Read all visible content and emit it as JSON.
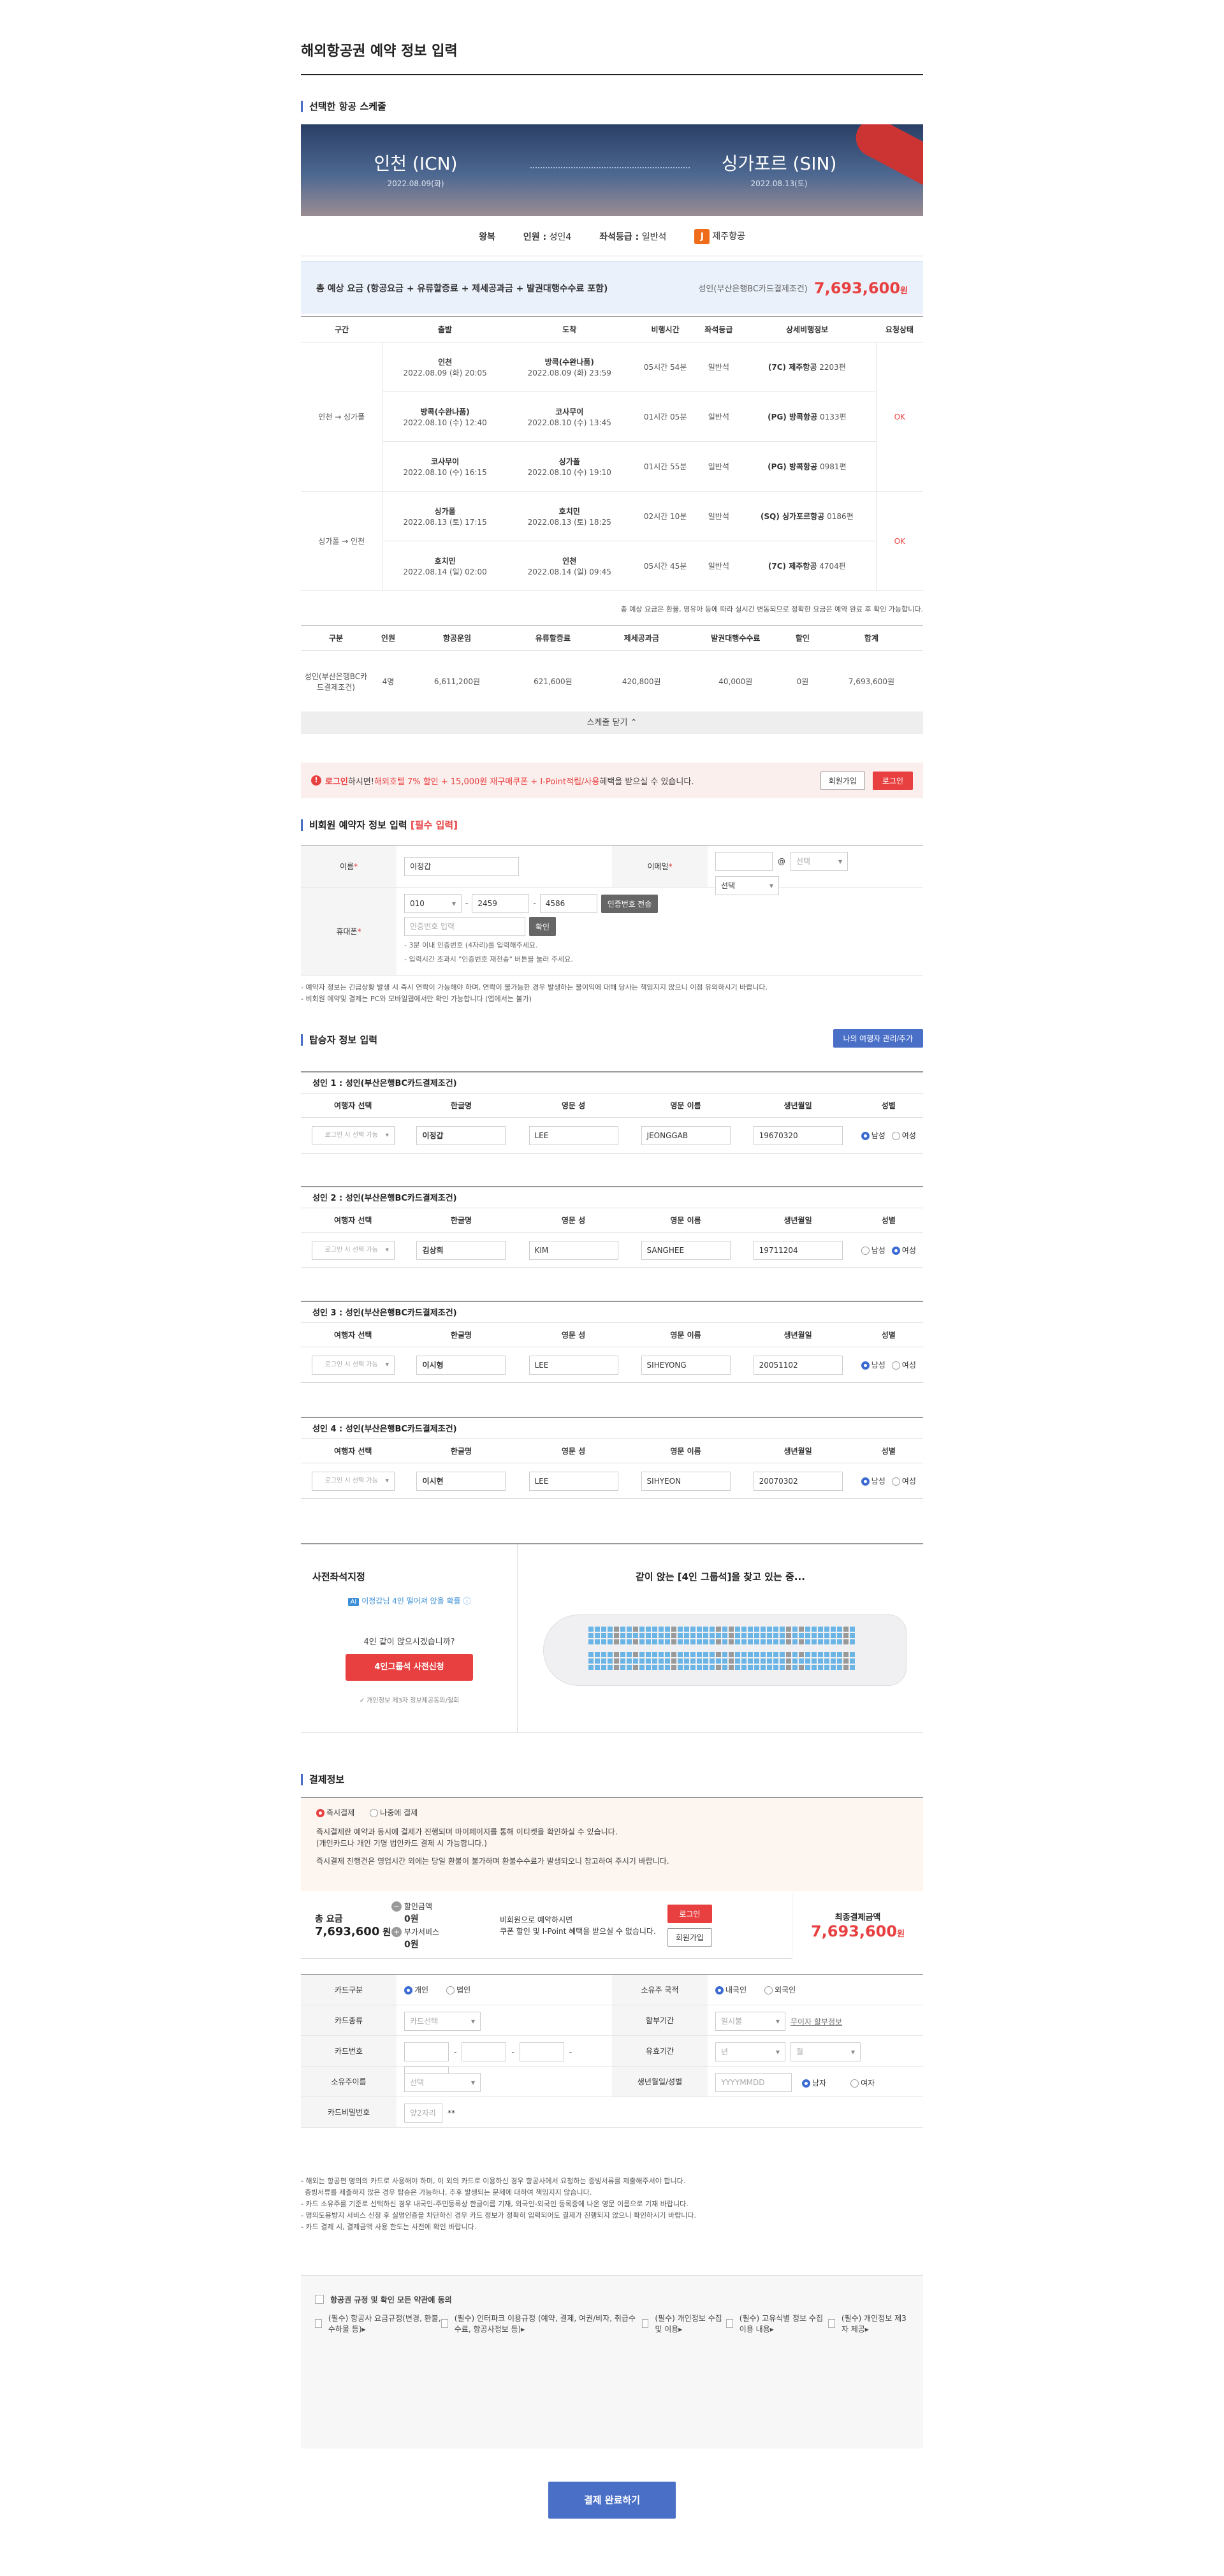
{
  "page_title": "해외항공권 예약 정보 입력",
  "schedule": {
    "section_title": "선택한 항공 스케줄",
    "from_city": "인천 (ICN)",
    "from_date": "2022.08.09(화)",
    "to_city": "싱가포르 (SIN)",
    "to_date": "2022.08.13(토)",
    "trip_type": "왕복",
    "pax_label": "인원 :",
    "pax_value": "성인4",
    "class_label": "좌석등급 :",
    "class_value": "일반석",
    "airline": "제주항공",
    "airline_icon": "J",
    "fare_label": "총 예상 요금 (항공요금 + 유류할증료 + 제세공과금 + 발권대행수수료 포함)",
    "fare_sub": "성인(부산은행BC카드결제조건)",
    "fare_amount": "7,693,600",
    "fare_unit": "원",
    "headers": [
      "구간",
      "출발",
      "도착",
      "비행시간",
      "좌석등급",
      "상세비행정보",
      "요청상태"
    ],
    "segments": [
      {
        "route": "인천 → 싱가폴",
        "status": "OK",
        "rows": [
          {
            "dep": "인천",
            "dep_time": "2022.08.09 (화) 20:05",
            "arr": "방콕(수완나품)",
            "arr_time": "2022.08.09 (화) 23:59",
            "dur": "05시간 54분",
            "cls": "일반석",
            "code": "(7C) 제주항공",
            "flight": "2203편"
          },
          {
            "dep": "방콕(수완나품)",
            "dep_time": "2022.08.10 (수) 12:40",
            "arr": "코사무이",
            "arr_time": "2022.08.10 (수) 13:45",
            "dur": "01시간 05분",
            "cls": "일반석",
            "code": "(PG) 방콕항공",
            "flight": "0133편"
          },
          {
            "dep": "코사무이",
            "dep_time": "2022.08.10 (수) 16:15",
            "arr": "싱가폴",
            "arr_time": "2022.08.10 (수) 19:10",
            "dur": "01시간 55분",
            "cls": "일반석",
            "code": "(PG) 방콕항공",
            "flight": "0981편"
          }
        ]
      },
      {
        "route": "싱가폴 → 인천",
        "status": "OK",
        "rows": [
          {
            "dep": "싱가폴",
            "dep_time": "2022.08.13 (토) 17:15",
            "arr": "호치민",
            "arr_time": "2022.08.13 (토) 18:25",
            "dur": "02시간 10분",
            "cls": "일반석",
            "code": "(SQ) 싱가포르항공",
            "flight": "0186편"
          },
          {
            "dep": "호치민",
            "dep_time": "2022.08.14 (일) 02:00",
            "arr": "인천",
            "arr_time": "2022.08.14 (일) 09:45",
            "dur": "05시간 45분",
            "cls": "일반석",
            "code": "(7C) 제주항공",
            "flight": "4704편"
          }
        ]
      }
    ],
    "note": "총 예상 요금은 환율, 영유아 등에 따라 실시간 변동되므로 정확한 요금은 예약 완료 후 확인 가능합니다.",
    "price_headers": [
      "구분",
      "인원",
      "항공운임",
      "유류할증료",
      "제세공과금",
      "발권대행수수료",
      "할인",
      "합계"
    ],
    "price_row": [
      "성인(부산은행BC카드결제조건)",
      "4명",
      "6,611,200원",
      "621,600원",
      "420,800원",
      "40,000원",
      "0원",
      "7,693,600원"
    ],
    "fold": "스케줄 닫기 ⌃"
  },
  "promo": {
    "login": "로그인",
    "text1": "하시면! ",
    "hl": "해외호텔 7% 할인 + 15,000원 재구매쿠폰 + I-Point적립/사용",
    "text2": " 혜택을 받으실 수 있습니다.",
    "join": "회원가입",
    "login_btn": "로그인"
  },
  "booker": {
    "title": "비회원 예약자 정보 입력",
    "req": "[필수 입력]",
    "name_label": "이름",
    "name": "이정갑",
    "email_label": "이메일",
    "email_sel": "선택",
    "email_sel2": "선택",
    "phone_label": "휴대폰",
    "p1": "010",
    "p2": "2459",
    "p3": "4586",
    "send": "인증번호 전송",
    "code_ph": "인증번호 입력",
    "confirm": "확인",
    "hint1": "- 3분 이내 인증번호 (4자리)를 입력해주세요.",
    "hint2": "- 입력시간 초과시 \"인증번호 재전송\" 버튼을 눌러 주세요.",
    "note1": "- 예약자 정보는 긴급상황 발생 시 즉시 연락이 가능해야 하며, 연락이 불가능한 경우 발생하는 불이익에 대해 당사는 책임지지 않으니 이점 유의하시기 바랍니다.",
    "note2": "- 비회원 예약및 결제는 PC와 모바일웹에서만 확인 가능합니다 (앱에서는 불가)"
  },
  "passengers": {
    "title": "탑승자 정보 입력",
    "manage": "나의 여행자 관리/추가",
    "headers": [
      "여행자 선택",
      "한글명",
      "영문 성",
      "영문 이름",
      "생년월일",
      "성별"
    ],
    "select_ph": "로그인 시 선택 가능",
    "male": "남성",
    "female": "여성",
    "list": [
      {
        "title": "성인 1 : 성인(부산은행BC카드결제조건)",
        "kr": "이정갑",
        "last": "LEE",
        "first": "JEONGGAB",
        "birth": "19670320",
        "gender": "m"
      },
      {
        "title": "성인 2 : 성인(부산은행BC카드결제조건)",
        "kr": "김상희",
        "last": "KIM",
        "first": "SANGHEE",
        "birth": "19711204",
        "gender": "f"
      },
      {
        "title": "성인 3 : 성인(부산은행BC카드결제조건)",
        "kr": "이시형",
        "last": "LEE",
        "first": "SIHEYONG",
        "birth": "20051102",
        "gender": "m"
      },
      {
        "title": "성인 4 : 성인(부산은행BC카드결제조건)",
        "kr": "이시현",
        "last": "LEE",
        "first": "SIHYEON",
        "birth": "20070302",
        "gender": "m"
      }
    ]
  },
  "seat": {
    "title": "사전좌석지정",
    "ai": "AI",
    "ai_text": "이정갑님 4인 떨어져 앉을 확률",
    "q": "4인 같이 앉으시겠습니까?",
    "btn": "4인그룹석 사전신청",
    "privacy": "개인정보 제3자 정보제공동의/철회",
    "right_title": "같이 앉는 [4인 그룹석]을 찾고 있는 중..."
  },
  "payment": {
    "title": "결제정보",
    "now": "즉시결제",
    "later": "나중에 결제",
    "d1": "즉시결제란 예약과 동시에 결제가 진행되며 마이페이지를 통해 이티켓을 확인하실 수 있습니다.",
    "d2": "(개인카드나 개인 기명 법인카드 결제 시 가능합니다.)",
    "d3": "즉시결제 진행건은 영업시간 외에는 당일 환불이 불가하며 환불수수료가 발생되오니 참고하여 주시기 바랍니다.",
    "total_label": "총 요금",
    "total": "7,693,600",
    "won": "원",
    "disc_label": "할인금액",
    "disc": "0원",
    "add_label": "부가서비스",
    "add": "0원",
    "mem1": "비회원으로 예약하시면",
    "mem2": "쿠폰 할인 및 I-Point 혜택을 받으실 수 없습니다.",
    "login": "로그인",
    "join": "회원가입",
    "final_label": "최종결제금액",
    "final": "7,693,600",
    "card_type": "카드구분",
    "personal": "개인",
    "corp": "법인",
    "nation": "소유주 국적",
    "domestic": "내국인",
    "foreign": "외국인",
    "card_kind": "카드종류",
    "card_sel": "카드선택",
    "inst": "할부기간",
    "inst_sel": "일시불",
    "inst_link": "무이자 할부정보",
    "card_no": "카드번호",
    "expiry": "유효기간",
    "year": "년",
    "month": "월",
    "owner": "소유주이름",
    "owner_sel": "선택",
    "birth_gender": "생년월일/성별",
    "birth_ph": "YYYYMMDD",
    "male": "남자",
    "female": "여자",
    "pw": "카드비밀번호",
    "pw_ph": "앞2자리",
    "pw_mask": "**",
    "n1": "- 해외는 항공편 명의의 카드로 사용해야 하며, 이 외의 카드로 이용하신 경우 항공사에서 요청하는 증빙서류를 제출해주셔야 합니다.",
    "n1b": "증빙서류를 제출하지 않은 경우 탑승은 가능하나, 추후 발생되는 문제에 대하여 책임지지 않습니다.",
    "n2": "- 카드 소유주를 기준로 선택하신 경우 내국인-주민등록상 한글이름 기재, 외국인-외국인 등록증에 나온 영문 이름으로 기재 바랍니다.",
    "n3": "- 명의도용방지 서비스 신청 후 실명인증을 차단하신 경우 카드 정보가 정확히 입력되어도 결제가 진행되지 않으니 확인하시기 바랍니다.",
    "n4": "- 카드 결제 시, 결제금액 사용 한도는 사전에 확인 바랍니다."
  },
  "agree": {
    "all": "항공권 규정 및 확인 모든 약관에 동의",
    "items": [
      "(필수) 항공사 요금규정(변경, 환불, 수하물 등)▸",
      "(필수) 인터파크 이용규정 (예약, 결제, 여권/비자, 취급수수료, 항공사정보 등)▸",
      "(필수) 개인정보 수집 및 이용▸",
      "(필수) 고유식별 정보 수집 이용 내용▸",
      "(필수) 개인정보 제3자 제공▸"
    ]
  },
  "submit": "결제 완료하기"
}
